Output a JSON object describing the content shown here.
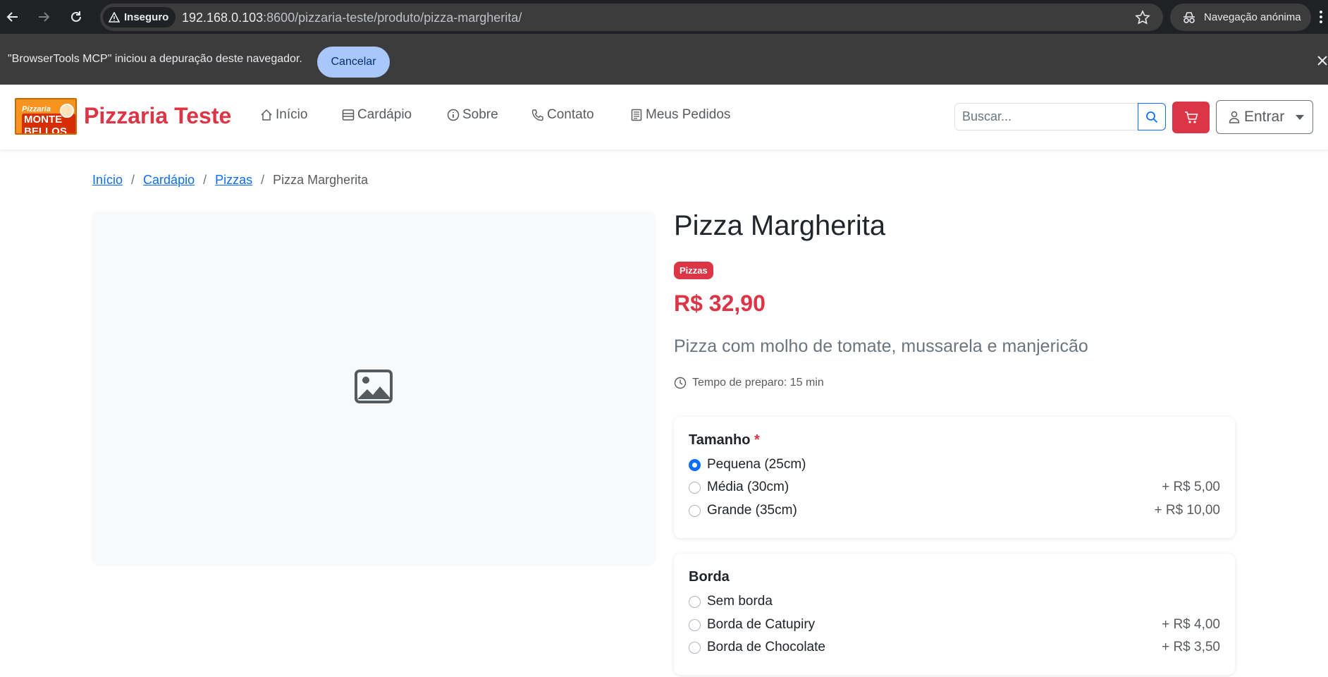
{
  "browser": {
    "security_label": "Inseguro",
    "url_host": "192.168.0.103",
    "url_rest": ":8600/pizzaria-teste/produto/pizza-margherita/",
    "incognito_label": "Navegação anónima"
  },
  "infobar": {
    "message": "\"BrowserTools MCP\" iniciou a depuração deste navegador.",
    "cancel_label": "Cancelar"
  },
  "site": {
    "logo_line1": "Pizzaria",
    "logo_line2": "MONTE BELLOS",
    "brand": "Pizzaria Teste",
    "nav": {
      "inicio": "Início",
      "cardapio": "Cardápio",
      "sobre": "Sobre",
      "contato": "Contato",
      "pedidos": "Meus Pedidos"
    },
    "search_placeholder": "Buscar...",
    "login_label": "Entrar"
  },
  "breadcrumb": [
    "Início",
    "Cardápio",
    "Pizzas",
    "Pizza Margherita"
  ],
  "product": {
    "title": "Pizza Margherita",
    "category": "Pizzas",
    "price": "R$ 32,90",
    "description": "Pizza com molho de tomate, mussarela e manjericão",
    "prep_time": "Tempo de preparo: 15 min"
  },
  "options": {
    "size": {
      "title": "Tamanho",
      "required_mark": "*",
      "items": [
        {
          "label": "Pequena (25cm)",
          "price": "",
          "selected": true
        },
        {
          "label": "Média (30cm)",
          "price": "+ R$ 5,00",
          "selected": false
        },
        {
          "label": "Grande (35cm)",
          "price": "+ R$ 10,00",
          "selected": false
        }
      ]
    },
    "crust": {
      "title": "Borda",
      "items": [
        {
          "label": "Sem borda",
          "price": "",
          "selected": false
        },
        {
          "label": "Borda de Catupiry",
          "price": "+ R$ 4,00",
          "selected": false
        },
        {
          "label": "Borda de Chocolate",
          "price": "+ R$ 3,50",
          "selected": false
        }
      ]
    }
  },
  "colors": {
    "brand_red": "#dc3545",
    "link_blue": "#0d6efd",
    "chrome_dark": "#202124"
  }
}
